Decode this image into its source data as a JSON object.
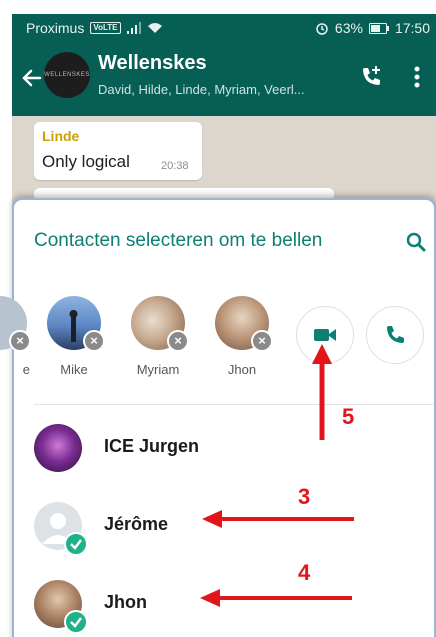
{
  "status_bar": {
    "carrier": "Proximus",
    "volte": "VoLTE",
    "battery": "63%",
    "time": "17:50"
  },
  "chat": {
    "title": "Wellenskes",
    "members": "David, Hilde, Linde, Myriam, Veerl...",
    "avatar_text": "WELLENSKES",
    "message": {
      "sender": "Linde",
      "text": "Only logical",
      "time": "20:38"
    }
  },
  "sheet": {
    "title": "Contacten selecteren om te bellen",
    "selected": [
      {
        "name": "e"
      },
      {
        "name": "Mike"
      },
      {
        "name": "Myriam"
      },
      {
        "name": "Jhon"
      }
    ],
    "contacts": [
      {
        "name": "ICE Jurgen",
        "selected": false
      },
      {
        "name": "Jérôme",
        "selected": true
      },
      {
        "name": "Jhon",
        "selected": true
      }
    ]
  },
  "annotations": {
    "video_call": "5",
    "jerome": "3",
    "jhon": "4"
  },
  "colors": {
    "header": "#075e54",
    "accent": "#0d7f73",
    "check": "#1fb28a",
    "annotation": "#e0161b"
  }
}
